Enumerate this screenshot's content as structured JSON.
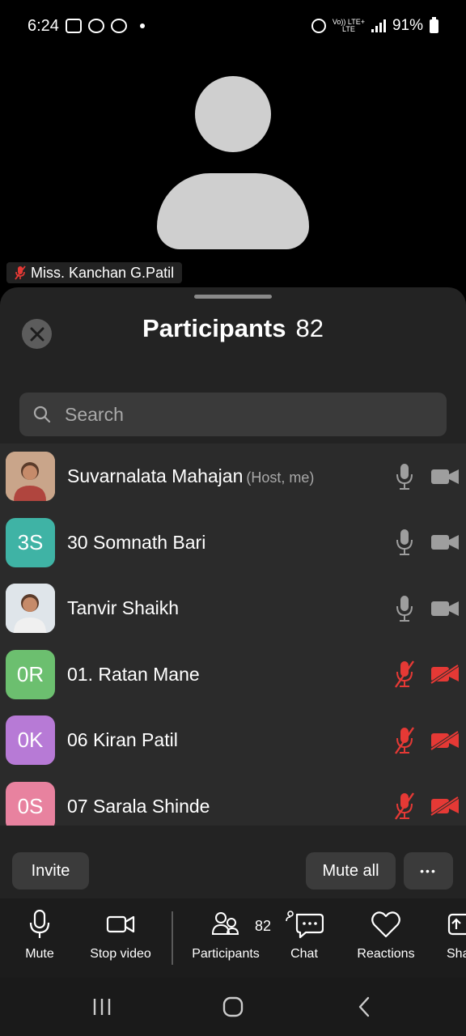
{
  "status_bar": {
    "time": "6:24",
    "network_top": "Vo)) LTE+",
    "network_bottom": "LTE",
    "battery": "91%"
  },
  "video": {
    "active_speaker_name": "Miss. Kanchan G.Patil"
  },
  "participants_panel": {
    "title": "Participants",
    "count": "82",
    "search_placeholder": "Search",
    "participants": [
      {
        "name": "Suvarnalata Mahajan",
        "tag": "(Host, me)",
        "initials": "",
        "avatar_color": "#c9a58a",
        "has_photo": true,
        "muted": false,
        "video_off": false
      },
      {
        "name": "30 Somnath Bari",
        "tag": "",
        "initials": "3S",
        "avatar_color": "#3fb3a5",
        "has_photo": false,
        "muted": false,
        "video_off": false
      },
      {
        "name": "Tanvir Shaikh",
        "tag": "",
        "initials": "",
        "avatar_color": "#dfe5ea",
        "has_photo": true,
        "muted": false,
        "video_off": false
      },
      {
        "name": "01. Ratan Mane",
        "tag": "",
        "initials": "0R",
        "avatar_color": "#6cbf6f",
        "has_photo": false,
        "muted": true,
        "video_off": true
      },
      {
        "name": "06 Kiran Patil",
        "tag": "",
        "initials": "0K",
        "avatar_color": "#b77ad6",
        "has_photo": false,
        "muted": true,
        "video_off": true
      },
      {
        "name": "07 Sarala Shinde",
        "tag": "",
        "initials": "0S",
        "avatar_color": "#e8829f",
        "has_photo": false,
        "muted": true,
        "video_off": true
      }
    ],
    "invite_label": "Invite",
    "mute_all_label": "Mute all",
    "more_label": "•••"
  },
  "toolbar": {
    "mute_label": "Mute",
    "stop_video_label": "Stop video",
    "participants_label": "Participants",
    "participants_count": "82",
    "chat_label": "Chat",
    "reactions_label": "Reactions",
    "share_label": "Sha"
  },
  "colors": {
    "muted_red": "#e53935",
    "icon_gray": "#9e9e9e"
  }
}
